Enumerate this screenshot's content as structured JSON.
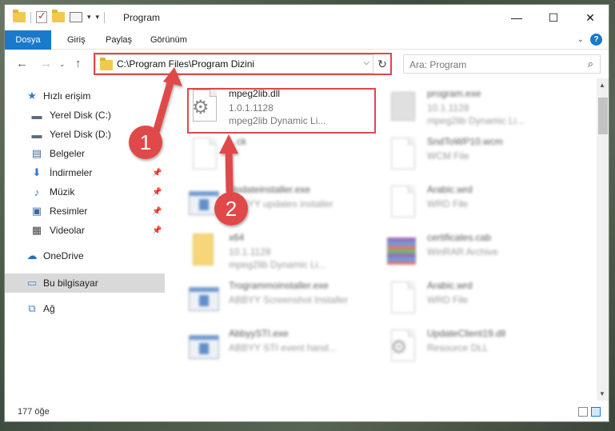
{
  "window": {
    "title": "Program",
    "controls": {
      "minimize": "—",
      "maximize": "☐",
      "close": "✕"
    }
  },
  "ribbon": {
    "tabs": [
      "Dosya",
      "Giriş",
      "Paylaş",
      "Görünüm"
    ],
    "accent": "#1979ca"
  },
  "nav": {
    "back": "←",
    "forward": "→",
    "up": "↑",
    "path": "C:\\Program Files\\Program Dizini",
    "search_placeholder": "Ara: Program"
  },
  "sidebar": {
    "items": [
      {
        "label": "Hızlı erişim",
        "icon": "star-icon"
      },
      {
        "label": "Yerel Disk (C:)",
        "icon": "drive-icon"
      },
      {
        "label": "Yerel Disk (D:)",
        "icon": "drive-icon"
      },
      {
        "label": "Belgeler",
        "icon": "documents-icon"
      },
      {
        "label": "İndirmeler",
        "icon": "download-icon"
      },
      {
        "label": "Müzik",
        "icon": "music-icon"
      },
      {
        "label": "Resimler",
        "icon": "pictures-icon"
      },
      {
        "label": "Videolar",
        "icon": "video-icon"
      },
      {
        "label": "OneDrive",
        "icon": "cloud-icon"
      },
      {
        "label": "Bu bilgisayar",
        "icon": "computer-icon"
      },
      {
        "label": "Ağ",
        "icon": "network-icon"
      }
    ]
  },
  "files": [
    {
      "name": "mpeg2lib.dll",
      "line2": "1.0.1.1128",
      "line3": "mpeg2lib Dynamic Li...",
      "icon": "dll-icon"
    },
    {
      "name": "program.exe",
      "line2": "10.1.1128",
      "line3": "mpeg2lib Dynamic Li...",
      "icon": "program-icon"
    },
    {
      "name": "...ck",
      "line2": "",
      "line3": "",
      "icon": "file-icon"
    },
    {
      "name": "SndToWP10.wcm",
      "line2": "WCM File",
      "line3": "",
      "icon": "file-icon"
    },
    {
      "name": "Updateinstaller.exe",
      "line2": "ABBYY updates installer",
      "line3": "",
      "icon": "exe-icon"
    },
    {
      "name": "Arabic.wrd",
      "line2": "WRD File",
      "line3": "",
      "icon": "file-icon"
    },
    {
      "name": "x64",
      "line2": "10.1.1128",
      "line3": "mpeg2lib Dynamic Li...",
      "icon": "folder-icon"
    },
    {
      "name": "certificates.cab",
      "line2": "WinRAR Archive",
      "line3": "",
      "icon": "archive-icon"
    },
    {
      "name": "Trogrammoinstaller.exe",
      "line2": "ABBYY Screenshot Installer",
      "line3": "",
      "icon": "exe-icon"
    },
    {
      "name": "Arabic.wrd",
      "line2": "WRD File",
      "line3": "",
      "icon": "file-icon"
    },
    {
      "name": "AbbyySTI.exe",
      "line2": "ABBYY STI event hand...",
      "line3": "",
      "icon": "exe-icon"
    },
    {
      "name": "UpdateClient19.dll",
      "line2": "Resource DLL",
      "line3": "",
      "icon": "dll-icon"
    }
  ],
  "annotations": {
    "step1": "1",
    "step2": "2",
    "color": "#d84a4a"
  },
  "status": {
    "count": "177 öğe"
  }
}
